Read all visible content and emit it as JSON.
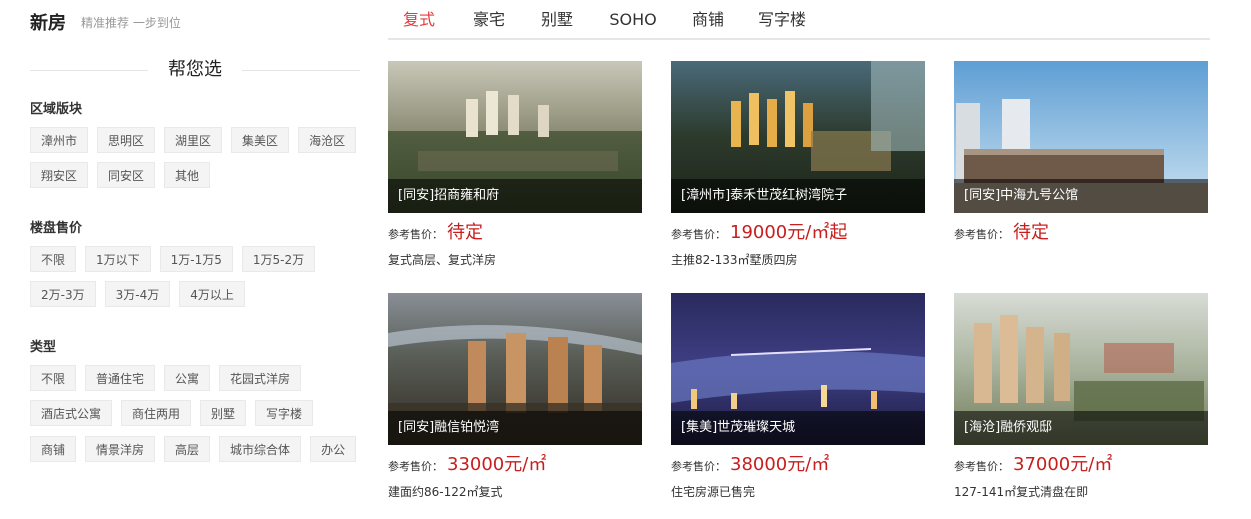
{
  "header": {
    "title": "新房",
    "subtitle": "精准推荐 一步到位",
    "tabs": [
      {
        "label": "复式",
        "active": true
      },
      {
        "label": "豪宅",
        "active": false
      },
      {
        "label": "别墅",
        "active": false
      },
      {
        "label": "SOHO",
        "active": false
      },
      {
        "label": "商铺",
        "active": false
      },
      {
        "label": "写字楼",
        "active": false
      }
    ]
  },
  "sidebar": {
    "heading": "帮您选",
    "groups": [
      {
        "title": "区域版块",
        "rows": [
          [
            "漳州市",
            "思明区",
            "湖里区",
            "集美区",
            "海沧区"
          ],
          [
            "翔安区",
            "同安区",
            "其他"
          ]
        ]
      },
      {
        "title": "楼盘售价",
        "rows": [
          [
            "不限",
            "1万以下",
            "1万-1万5",
            "1万5-2万"
          ],
          [
            "2万-3万",
            "3万-4万",
            "4万以上"
          ]
        ]
      },
      {
        "title": "类型",
        "rows": [
          [
            "不限",
            "普通住宅",
            "公寓",
            "花园式洋房"
          ],
          [
            "酒店式公寓",
            "商住两用",
            "别墅",
            "写字楼"
          ],
          [
            "商铺",
            "情景洋房",
            "高层",
            "城市综合体",
            "办公"
          ]
        ]
      }
    ]
  },
  "price_label": "参考售价：",
  "cards": [
    {
      "caption": "[同安]招商雍和府",
      "price": "待定",
      "desc": "复式高层、复式洋房",
      "scene": "dusk"
    },
    {
      "caption": "[漳州市]泰禾世茂红树湾院子",
      "price": "19000元/㎡起",
      "desc": "主推82-133㎡墅质四房",
      "scene": "night-lights"
    },
    {
      "caption": "[同安]中海九号公馆",
      "price": "待定",
      "desc": "",
      "scene": "day-facade"
    },
    {
      "caption": "[同安]融信铂悦湾",
      "price": "33000元/㎡",
      "desc": "建面约86-122㎡复式",
      "scene": "river-towers"
    },
    {
      "caption": "[集美]世茂璀璨天城",
      "price": "38000元/㎡",
      "desc": "住宅房源已售完",
      "scene": "night-bay"
    },
    {
      "caption": "[海沧]融侨观邸",
      "price": "37000元/㎡",
      "desc": "127-141㎡复式清盘在即",
      "scene": "day-towers"
    }
  ]
}
